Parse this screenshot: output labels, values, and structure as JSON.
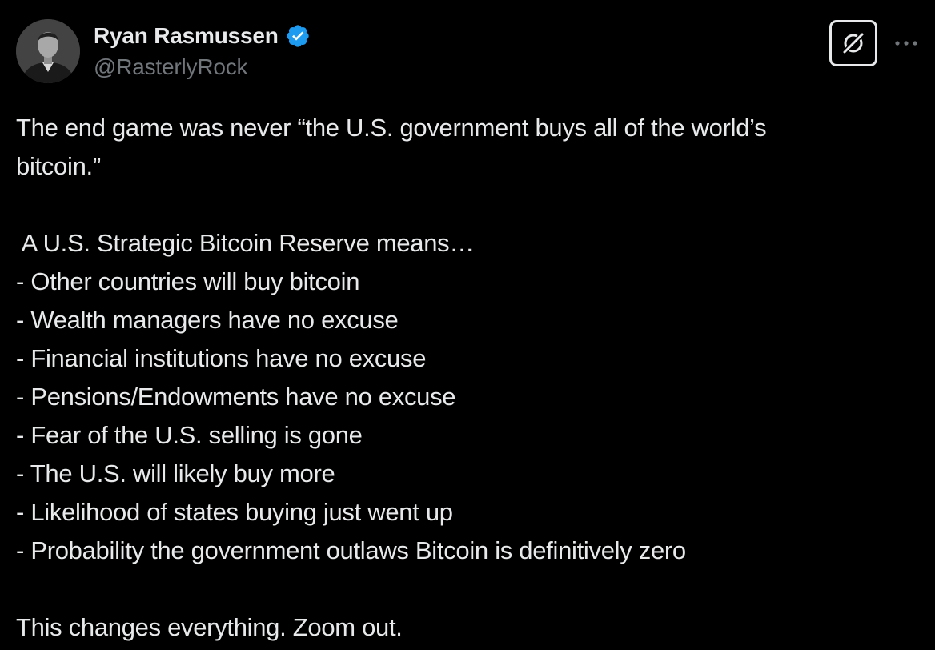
{
  "author": {
    "display_name": "Ryan Rasmussen",
    "handle": "@RasterlyRock",
    "verified": true,
    "avatar": "avatar-photo"
  },
  "actions": {
    "grok_icon": "grok-icon",
    "more_icon": "more-icon"
  },
  "colors": {
    "background": "#000000",
    "text": "#e7e9ea",
    "secondary_text": "#71767b",
    "verified_badge": "#1d9bf0"
  },
  "tweet": {
    "intro_line_1": "The end game was never “the U.S. government buys all of the world’s",
    "intro_line_2": "bitcoin.”",
    "list_heading": " A U.S. Strategic Bitcoin Reserve means…",
    "list_items": [
      "- Other countries will buy bitcoin",
      "- Wealth managers have no excuse",
      "- Financial institutions have no excuse",
      "- Pensions/Endowments have no excuse",
      "- Fear of the U.S. selling is gone",
      "- The U.S. will likely buy more",
      "- Likelihood of states buying just went up",
      "- Probability the government outlaws Bitcoin is definitively zero"
    ],
    "closing": "This changes everything. Zoom out."
  }
}
